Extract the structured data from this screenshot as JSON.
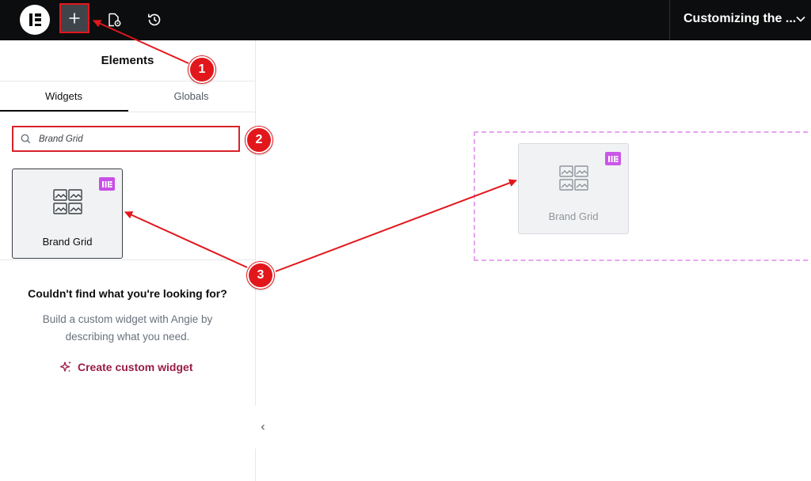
{
  "topbar": {
    "logo_icon": "elementor-logo-icon",
    "add_icon": "plus-icon",
    "page_settings_icon": "page-settings-icon",
    "history_icon": "history-icon",
    "document_title": "Customizing the ...",
    "dropdown_icon": "chevron-down-icon"
  },
  "panel": {
    "title": "Elements",
    "tabs": [
      {
        "label": "Widgets",
        "active": true
      },
      {
        "label": "Globals",
        "active": false
      }
    ],
    "search": {
      "value": "Brand Grid",
      "icon": "search-icon"
    },
    "widgets": [
      {
        "label": "Brand Grid",
        "icon": "brand-grid-icon",
        "badge": "pro-badge-icon"
      }
    ],
    "not_found": {
      "title": "Couldn't find what you're looking for?",
      "description": "Build a custom widget with Angie by describing what you need.",
      "link_label": "Create custom widget",
      "link_icon": "sparkle-icon"
    },
    "collapse_icon": "chevron-left-icon"
  },
  "canvas": {
    "dragged_widget": {
      "label": "Brand Grid",
      "icon": "brand-grid-icon",
      "badge": "pro-badge-icon"
    }
  },
  "annotations": {
    "markers": [
      "1",
      "2",
      "3"
    ],
    "color": "#e2171c"
  },
  "colors": {
    "topbar": "#0c0d0e",
    "highlight": "#e2171c",
    "pro_badge": "#c94ee7",
    "link": "#9a1b47",
    "drop_zone": "#e6a5ef"
  }
}
